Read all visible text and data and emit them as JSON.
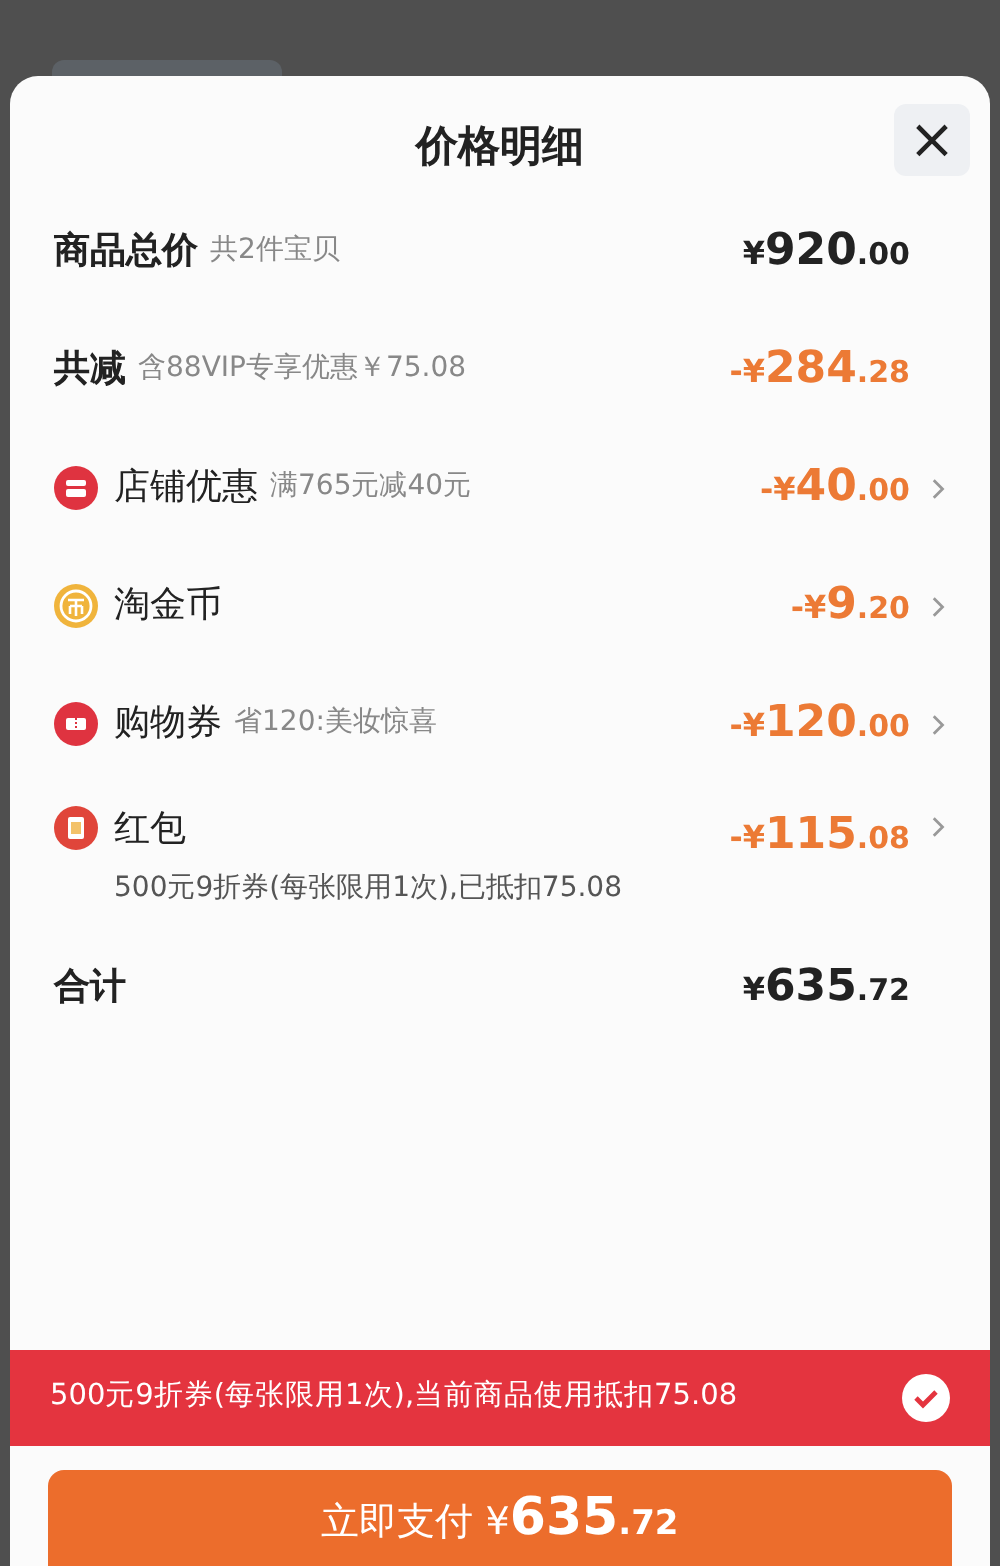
{
  "sheet": {
    "title": "价格明细",
    "close": "×"
  },
  "rows": [
    {
      "kind": "plain",
      "label": "商品总价",
      "note": "共2件宝贝",
      "amount": {
        "prefix": "¥",
        "main": "920",
        "cents": ".00"
      },
      "chevron": false
    },
    {
      "kind": "saving",
      "label": "共减",
      "note": "含88VIP专享优惠￥75.08",
      "amount": {
        "prefix": "-¥",
        "main": "284",
        "cents": ".28"
      },
      "chevron": false
    },
    {
      "kind": "store",
      "label": "店铺优惠",
      "note": "满765元减40元",
      "amount": {
        "prefix": "-¥",
        "main": "40",
        "cents": ".00"
      },
      "chevron": true
    },
    {
      "kind": "coin",
      "label": "淘金币",
      "amount": {
        "prefix": "-¥",
        "main": "9",
        "cents": ".20"
      },
      "chevron": true
    },
    {
      "kind": "ticket",
      "label": "购物券",
      "note": "省120:美妆惊喜",
      "amount": {
        "prefix": "-¥",
        "main": "120",
        "cents": ".00"
      },
      "chevron": true
    },
    {
      "kind": "packet",
      "label": "红包",
      "amount": {
        "prefix": "-¥",
        "main": "115",
        "cents": ".08"
      },
      "chevron": true,
      "sub": "500元9折券(每张限用1次),已抵扣75.08"
    },
    {
      "kind": "plain",
      "label": "合计",
      "amount": {
        "prefix": "¥",
        "main": "635",
        "cents": ".72"
      },
      "chevron": false
    }
  ],
  "banner": {
    "text": "500元9折券(每张限用1次),当前商品使用抵扣75.08",
    "checked": true
  },
  "pay_button": {
    "label": "立即支付",
    "amount": {
      "prefix": "¥",
      "main": "635",
      "cents": ".72"
    }
  }
}
